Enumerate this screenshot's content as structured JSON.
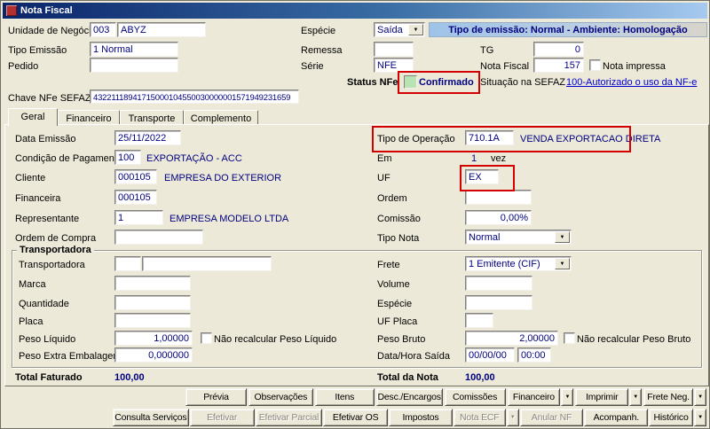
{
  "window": {
    "title": "Nota Fiscal"
  },
  "icons": {
    "dropdown": "▼"
  },
  "header": {
    "unidade": {
      "label": "Unidade de Negócio",
      "code": "003",
      "name": "ABYZ"
    },
    "especie": {
      "label": "Espécie",
      "value": "Saída"
    },
    "banner": "Tipo de emissão: Normal - Ambiente: Homologação",
    "tipo_emissao": {
      "label": "Tipo Emissão",
      "value": "1 Normal"
    },
    "remessa": {
      "label": "Remessa",
      "value": ""
    },
    "tg": {
      "label": "TG",
      "value": "0"
    },
    "pedido": {
      "label": "Pedido",
      "value": ""
    },
    "serie": {
      "label": "Série",
      "value": "NFE"
    },
    "nota_fiscal": {
      "label": "Nota Fiscal",
      "value": "157"
    },
    "nota_impressa_label": "Nota impressa",
    "status_nfe": {
      "label": "Status NFe",
      "value": "Confirmado"
    },
    "sefaz": {
      "label": "Situação na SEFAZ",
      "link": "100-Autorizado o uso da NF-e"
    },
    "chave": {
      "label": "Chave NFe SEFAZ",
      "value": "43221118941715000104550030000001571949231659"
    }
  },
  "tabs": {
    "geral": "Geral",
    "financeiro": "Financeiro",
    "transporte": "Transporte",
    "complemento": "Complemento"
  },
  "geral": {
    "data_emissao": {
      "label": "Data Emissão",
      "value": "25/11/2022"
    },
    "cond_pagamento": {
      "label": "Condição de Pagamento",
      "code": "100",
      "desc": "EXPORTAÇÃO - ACC"
    },
    "cliente": {
      "label": "Cliente",
      "code": "000105",
      "desc": "EMPRESA DO EXTERIOR"
    },
    "financeira": {
      "label": "Financeira",
      "code": "000105",
      "desc": ""
    },
    "representante": {
      "label": "Representante",
      "code": "1",
      "desc": "EMPRESA MODELO LTDA"
    },
    "ordem_compra": {
      "label": "Ordem de Compra",
      "value": ""
    },
    "tipo_operacao": {
      "label": "Tipo de Operação",
      "code": "710.1A",
      "desc": "VENDA EXPORTACAO DIRETA"
    },
    "em": {
      "label": "Em",
      "value": "1",
      "suffix": "vez"
    },
    "uf": {
      "label": "UF",
      "value": "EX"
    },
    "ordem": {
      "label": "Ordem",
      "value": ""
    },
    "comissao": {
      "label": "Comissão",
      "value": "0,00%"
    },
    "tipo_nota": {
      "label": "Tipo Nota",
      "value": "Normal"
    }
  },
  "transporte_group": {
    "title": "Transportadora",
    "transportadora": {
      "label": "Transportadora",
      "code": "",
      "name": ""
    },
    "marca": {
      "label": "Marca",
      "value": ""
    },
    "quantidade": {
      "label": "Quantidade",
      "value": ""
    },
    "placa": {
      "label": "Placa",
      "value": ""
    },
    "peso_liquido": {
      "label": "Peso Líquido",
      "value": "1,00000",
      "check_label": "Não recalcular Peso Líquido"
    },
    "peso_extra": {
      "label": "Peso Extra Embalagem",
      "value": "0,000000"
    },
    "frete": {
      "label": "Frete",
      "value": "1 Emitente (CIF)"
    },
    "volume": {
      "label": "Volume",
      "value": ""
    },
    "especie": {
      "label": "Espécie",
      "value": ""
    },
    "uf_placa": {
      "label": "UF Placa",
      "value": ""
    },
    "peso_bruto": {
      "label": "Peso Bruto",
      "value": "2,00000",
      "check_label": "Não recalcular Peso Bruto"
    },
    "saida": {
      "label": "Data/Hora Saída",
      "date": "00/00/00",
      "time": "00:00"
    }
  },
  "totais": {
    "faturado_label": "Total Faturado",
    "faturado": "100,00",
    "nota_label": "Total da Nota",
    "nota": "100,00"
  },
  "actions": {
    "previa": "Prévia",
    "observacoes": "Observações",
    "itens": "Itens",
    "desc_encargos": "Desc./Encargos",
    "comissoes": "Comissões",
    "financeiro": "Financeiro",
    "imprimir": "Imprimir",
    "frete_neg": "Frete Neg.",
    "consulta_servicos": "Consulta Serviços",
    "efetivar": "Efetivar",
    "efetivar_parcial": "Efetivar Parcial",
    "efetivar_os": "Efetivar OS",
    "impostos": "Impostos",
    "nota_ecf": "Nota ECF",
    "anular_nf": "Anular NF",
    "acompanh": "Acompanh.",
    "historico": "Histórico"
  }
}
